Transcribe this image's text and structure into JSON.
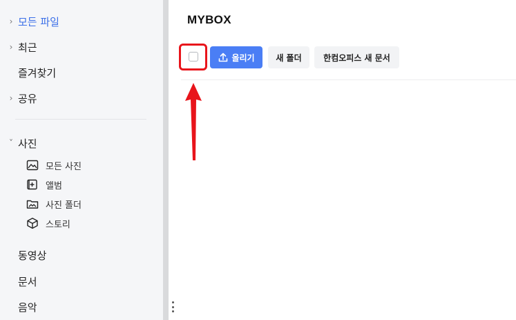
{
  "sidebar": {
    "items": [
      {
        "label": "모든 파일",
        "chevron": "›",
        "active": true
      },
      {
        "label": "최근",
        "chevron": "›"
      },
      {
        "label": "즐겨찾기"
      },
      {
        "label": "공유",
        "chevron": "›"
      }
    ],
    "photos": {
      "label": "사진",
      "chevron": "˅",
      "children": [
        {
          "label": "모든 사진",
          "icon": "image-icon"
        },
        {
          "label": "앨범",
          "icon": "album-add-icon"
        },
        {
          "label": "사진 폴더",
          "icon": "photo-folder-icon"
        },
        {
          "label": "스토리",
          "icon": "cube-icon"
        }
      ]
    },
    "bottom_items": [
      {
        "label": "동영상"
      },
      {
        "label": "문서"
      },
      {
        "label": "음악"
      }
    ]
  },
  "main": {
    "title": "MYBOX",
    "toolbar": {
      "upload_label": "올리기",
      "new_folder_label": "새 폴더",
      "hancom_label": "한컴오피스 새 문서"
    }
  },
  "colors": {
    "accent": "#4a7ef5",
    "active_text": "#3b6fe8",
    "annotation": "#e8141b"
  }
}
